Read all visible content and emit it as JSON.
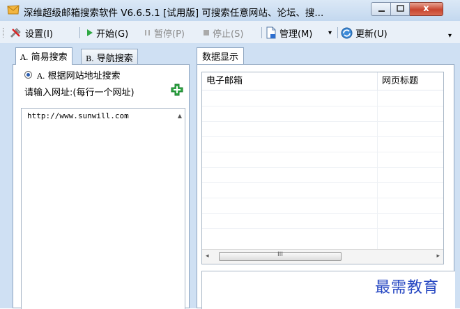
{
  "window": {
    "title": "深维超级邮箱搜索软件 V6.6.5.1 [试用版] 可搜索任意网站、论坛、搜...",
    "close_glyph": "x",
    "min_glyph": "▭",
    "max_glyph": "▢"
  },
  "toolbar": {
    "settings_label": "设置(I)",
    "start_label": "开始(G)",
    "pause_label": "暂停(P)",
    "stop_label": "停止(S)",
    "manage_label": "管理(M)",
    "manage_arrow": "▾",
    "update_label": "更新(U)",
    "overflow_glyph": "▾"
  },
  "left_panel": {
    "tabs": [
      {
        "prefix": "A.",
        "label": "简易搜索"
      },
      {
        "prefix": "B.",
        "label": "导航搜索"
      }
    ],
    "radio_prefix": "A.",
    "radio_label": "根据网站地址搜索",
    "prompt": "请输入网址:(每行一个网址)",
    "url_value": "http://www.sunwill.com"
  },
  "right_panel": {
    "tab": "数据显示",
    "columns": [
      "电子邮箱",
      "网页标题"
    ],
    "scroll_left": "◂",
    "scroll_right": "▸",
    "scroll_grip": "III"
  },
  "watermark": "最需教育",
  "colors": {
    "titlebar": "#c3d8ef",
    "toolbar": "#e9f0f8",
    "close_button": "#c8452f",
    "start_green": "#2ea843",
    "add_green": "#2ea843",
    "watermark": "#2647c2"
  }
}
